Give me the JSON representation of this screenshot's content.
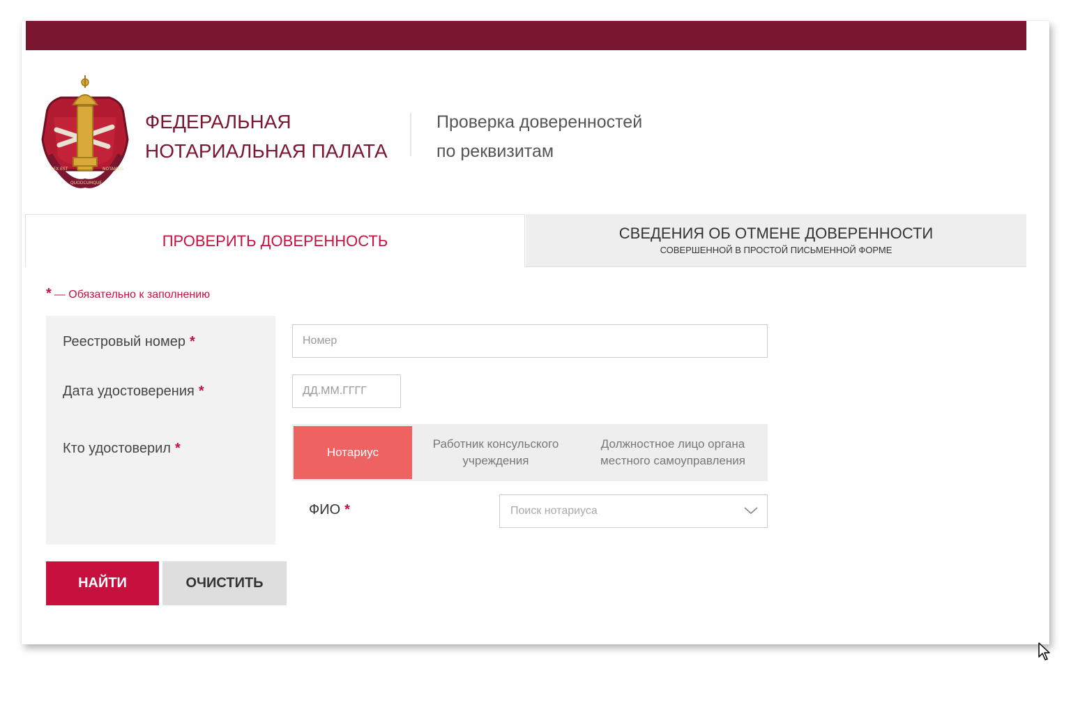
{
  "colors": {
    "brand_dark": "#7a1630",
    "accent": "#c8103e",
    "active_segment": "#ef6262",
    "panel_bg": "#f2f2f2"
  },
  "header": {
    "org_line1": "ФЕДЕРАЛЬНАЯ",
    "org_line2": "НОТАРИАЛЬНАЯ ПАЛАТА",
    "service_line1": "Проверка доверенностей",
    "service_line2": "по реквизитам",
    "emblem": {
      "icon": "notary-emblem-icon",
      "ribbon_left": "LEX EST",
      "ribbon_bottom": "QUODCUMQUE",
      "ribbon_right": "NOTAMUS"
    }
  },
  "tabs": [
    {
      "label": "ПРОВЕРИТЬ ДОВЕРЕННОСТЬ",
      "active": true
    },
    {
      "label": "СВЕДЕНИЯ ОБ ОТМЕНЕ ДОВЕРЕННОСТИ",
      "sublabel": "СОВЕРШЕННОЙ В ПРОСТОЙ ПИСЬМЕННОЙ ФОРМЕ",
      "active": false
    }
  ],
  "form": {
    "required_star": "*",
    "required_note": "— Обязательно к заполнению",
    "registry_number": {
      "label": "Реестровый номер",
      "placeholder": "Номер",
      "value": ""
    },
    "certification_date": {
      "label": "Дата удостоверения",
      "placeholder": "ДД.ММ.ГГГГ",
      "value": ""
    },
    "certified_by": {
      "label": "Кто удостоверил",
      "options": [
        {
          "label": "Нотариус",
          "selected": true
        },
        {
          "label": "Работник консульского учреждения",
          "selected": false
        },
        {
          "label": "Должностное лицо органа местного самоуправления",
          "selected": false
        }
      ]
    },
    "fio": {
      "label": "ФИО",
      "placeholder": "Поиск нотариуса",
      "icon": "chevron-down-icon"
    }
  },
  "actions": {
    "find": "НАЙТИ",
    "clear": "ОЧИСТИТЬ"
  }
}
